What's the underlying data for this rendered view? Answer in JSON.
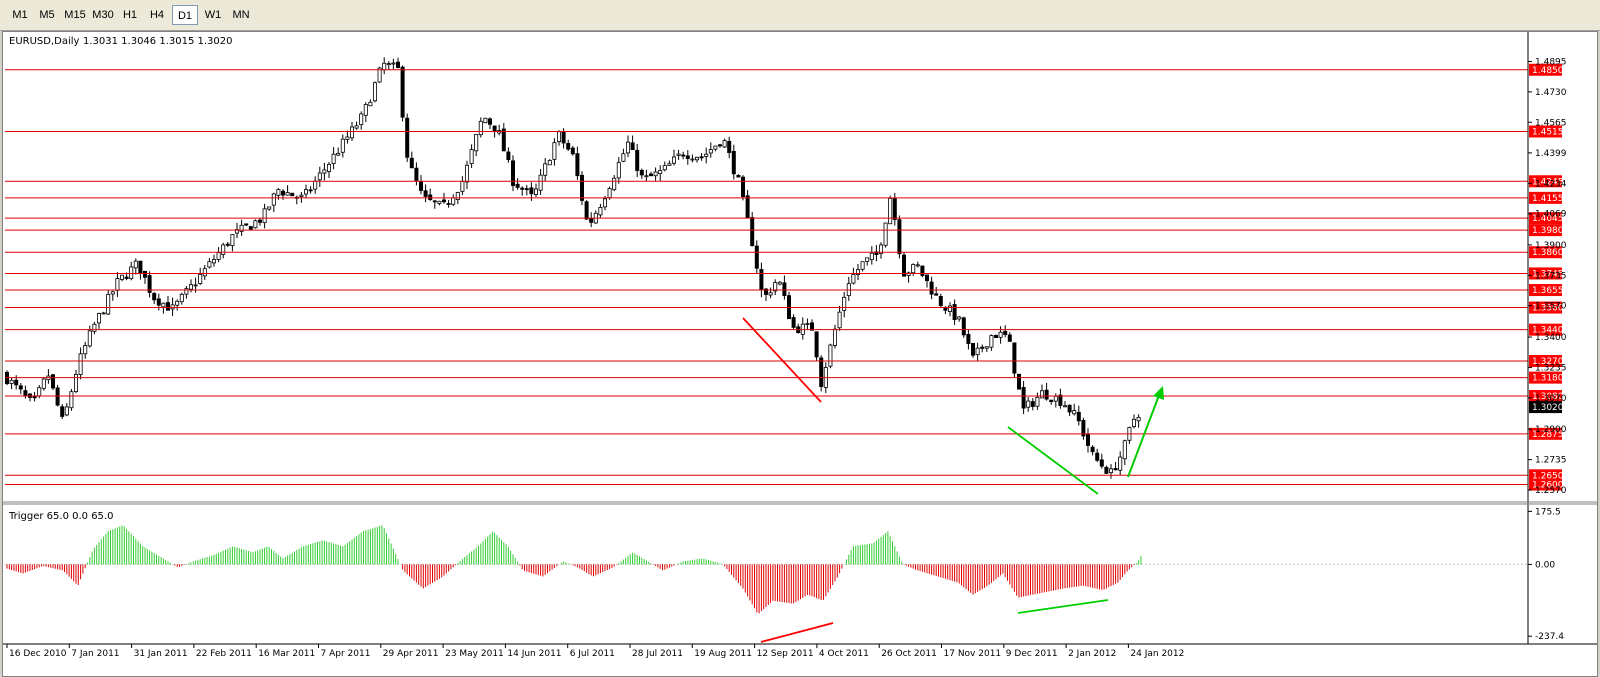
{
  "toolbar": {
    "timeframes": [
      "M1",
      "M5",
      "M15",
      "M30",
      "H1",
      "H4",
      "D1",
      "W1",
      "MN"
    ],
    "active_timeframe": "D1"
  },
  "main_chart": {
    "symbol_label": "EURUSD,Daily",
    "ohlc_label": "1.3031 1.3046 1.3015 1.3020",
    "current_price": "1.3020",
    "axis_ticks": [
      "1.4895",
      "1.4730",
      "1.4565",
      "1.4399",
      "1.4234",
      "1.4069",
      "1.3900",
      "1.3735",
      "1.3570",
      "1.3400",
      "1.3235",
      "1.3070",
      "1.2900",
      "1.2735",
      "1.2570"
    ],
    "support_resistance": [
      "1.4850",
      "1.4515",
      "1.4245",
      "1.4155",
      "1.4045",
      "1.3980",
      "1.3860",
      "1.3745",
      "1.3655",
      "1.3560",
      "1.3440",
      "1.3270",
      "1.3180",
      "1.3080",
      "1.2875",
      "1.2650",
      "1.2600"
    ],
    "colors": {
      "bull_candle": "#ffffff",
      "bear_candle": "#000000",
      "level_line": "#e00000",
      "label_bg": "#ff0000",
      "current_bg": "#000000",
      "divergence_down": "#ff0000",
      "divergence_up": "#00cc00"
    }
  },
  "indicator": {
    "label": "Trigger 65.0 0.0 65.0",
    "axis_ticks": [
      "175.5",
      "0.00",
      "-237.4"
    ],
    "colors": {
      "positive": "#33cc33",
      "negative": "#e00000"
    }
  },
  "x_axis": {
    "dates": [
      "16 Dec 2010",
      "7 Jan 2011",
      "31 Jan 2011",
      "22 Feb 2011",
      "16 Mar 2011",
      "7 Apr 2011",
      "29 Apr 2011",
      "23 May 2011",
      "14 Jun 2011",
      "6 Jul 2011",
      "28 Jul 2011",
      "19 Aug 2011",
      "12 Sep 2011",
      "4 Oct 2011",
      "26 Oct 2011",
      "17 Nov 2011",
      "9 Dec 2011",
      "2 Jan 2012",
      "24 Jan 2012"
    ]
  }
}
